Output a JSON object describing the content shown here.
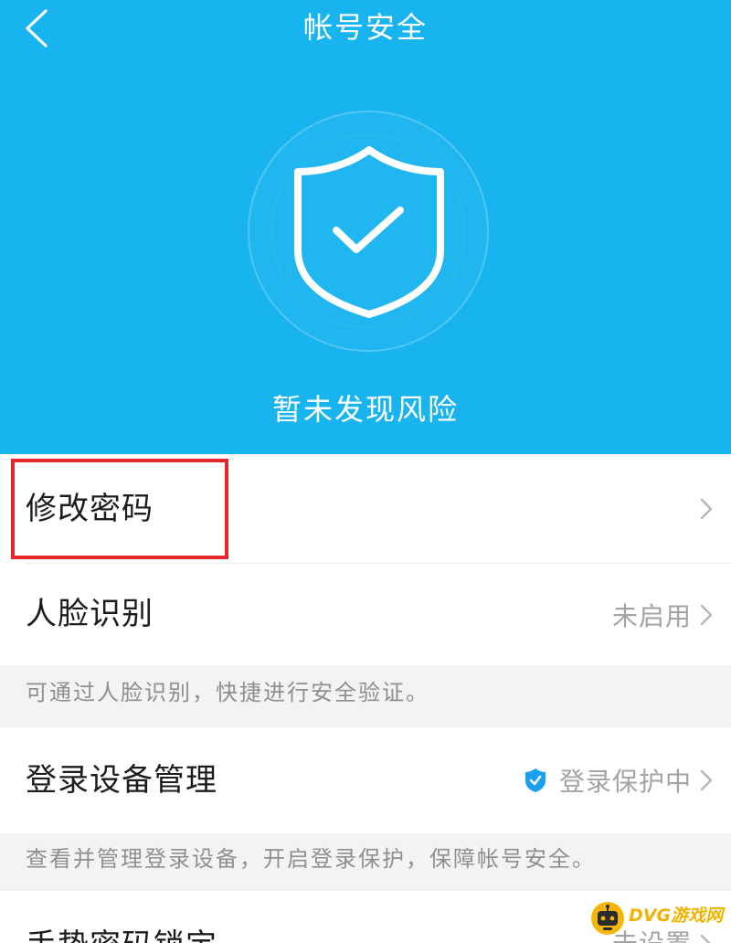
{
  "header": {
    "title": "帐号安全",
    "status_text": "暂未发现风险",
    "back_icon": "chevron-left-icon",
    "status_icon": "shield-check-icon"
  },
  "settings": [
    {
      "label": "修改密码",
      "chevron_icon": "chevron-right-icon"
    },
    {
      "label": "人脸识别",
      "value": "未启用",
      "chevron_icon": "chevron-right-icon",
      "description": "可通过人脸识别，快捷进行安全验证。"
    },
    {
      "label": "登录设备管理",
      "value": "登录保护中",
      "value_icon": "shield-check-icon",
      "chevron_icon": "chevron-right-icon",
      "description": "查看并管理登录设备，开启登录保护，保障帐号安全。"
    },
    {
      "label": "手势密码锁定",
      "value": "未设置",
      "chevron_icon": "chevron-right-icon"
    }
  ],
  "watermark": {
    "text": "DVG游戏网",
    "logo_icon": "robot-face-icon"
  },
  "colors": {
    "header_bg": "#18b4f0",
    "primary_text": "#1c1c1c",
    "secondary_text": "#a3a3a3",
    "description_text": "#8f8f8f",
    "description_bg": "#f2f3f5",
    "accent_blue": "#1a9ff0",
    "highlight": "#e5262c",
    "watermark": "#f2b300"
  }
}
